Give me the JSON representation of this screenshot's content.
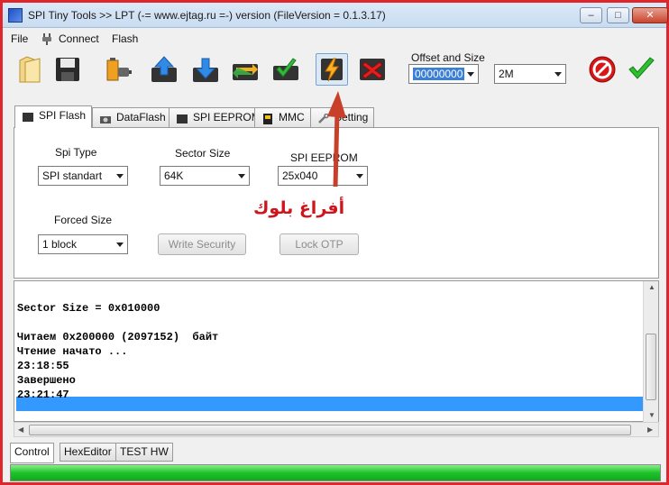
{
  "window": {
    "title": "SPI Tiny Tools >> LPT (-= www.ejtag.ru =-) version (FileVersion = 0.1.3.17)"
  },
  "menu": [
    "File",
    "Connect",
    "Flash"
  ],
  "toolbar": {
    "icons": [
      "open-folder",
      "save-disk",
      "battery-plug",
      "upload-arrow",
      "download-arrow",
      "refresh-chip",
      "check-chip",
      "flash-bolt",
      "delete-x",
      "stop-sign",
      "ok-check"
    ],
    "offset_label": "Offset and Size",
    "offset_value": "00000000",
    "size_value": "2M"
  },
  "tabs": [
    "SPI Flash",
    "DataFlash",
    "SPI EEPROM",
    "MMC",
    "Setting"
  ],
  "spi_flash": {
    "spi_type_label": "Spi Type",
    "spi_type_value": "SPI standart",
    "sector_size_label": "Sector Size",
    "sector_size_value": "64K",
    "eeprom_label": "SPI EEPROM",
    "eeprom_value": "25x040",
    "forced_size_label": "Forced Size",
    "forced_size_value": "1 block",
    "write_security": "Write Security",
    "lock_otp": "Lock OTP"
  },
  "annotation": "أفراغ بلوك",
  "log": [
    "",
    "Sector Size = 0x010000",
    "",
    "Читаем 0x200000 (2097152)  байт",
    "Чтение начато ...",
    "23:18:55",
    "Завершено",
    "23:21:47"
  ],
  "bottom_tabs": [
    "Control",
    "HexEditor",
    "TEST HW"
  ],
  "progress": 1.0,
  "colors": {
    "progress": "#1fc22a",
    "highlight": "#3399ff",
    "annotation": "#d0141e"
  }
}
